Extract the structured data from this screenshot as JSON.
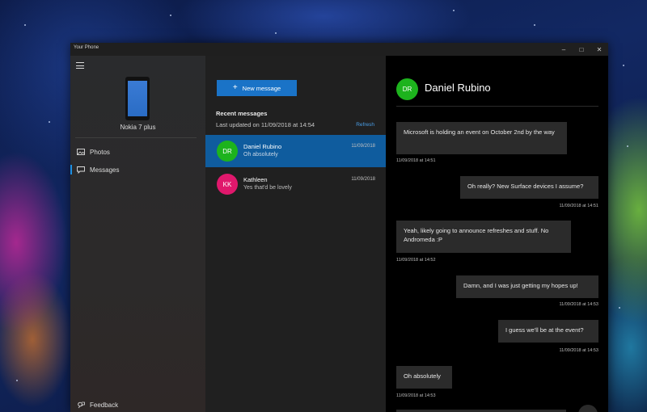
{
  "window": {
    "title": "Your Phone"
  },
  "nav": {
    "device_name": "Nokia 7 plus",
    "items": [
      {
        "label": "Photos",
        "icon": "photo-icon",
        "selected": false
      },
      {
        "label": "Messages",
        "icon": "message-icon",
        "selected": true
      }
    ],
    "feedback_label": "Feedback"
  },
  "list": {
    "new_message_label": "New message",
    "header": "Recent messages",
    "last_updated": "Last updated on 11/09/2018 at 14:54",
    "refresh_label": "Refresh",
    "threads": [
      {
        "initials": "DR",
        "name": "Daniel Rubino",
        "preview": "Oh absolutely",
        "date": "11/09/2018",
        "avatar_color": "#1db31d",
        "selected": true
      },
      {
        "initials": "KK",
        "name": "Kathleen",
        "preview": "Yes that'd be lovely",
        "date": "11/09/2018",
        "avatar_color": "#e0186c",
        "selected": false
      }
    ]
  },
  "conversation": {
    "initials": "DR",
    "contact_name": "Daniel Rubino",
    "messages": [
      {
        "text": "Microsoft is holding an event on October 2nd by the way",
        "time": "11/09/2018 at 14:51",
        "sent": false
      },
      {
        "text": "Oh really? New Surface devices I assume?",
        "time": "11/09/2018 at 14:51",
        "sent": true
      },
      {
        "text": "Yeah, likely going to announce refreshes and stuff. No Andromeda :P",
        "time": "11/09/2018 at 14:52",
        "sent": false
      },
      {
        "text": "Damn, and I was just getting my hopes up!",
        "time": "11/09/2018 at 14:53",
        "sent": true
      },
      {
        "text": "I guess we'll be at the event?",
        "time": "11/09/2018 at 14:53",
        "sent": true
      },
      {
        "text": "Oh absolutely",
        "time": "11/09/2018 at 14:53",
        "sent": false
      }
    ]
  },
  "colors": {
    "accent": "#1a73c7",
    "selected_thread": "#0f5c9e",
    "link": "#4a9fe8"
  }
}
